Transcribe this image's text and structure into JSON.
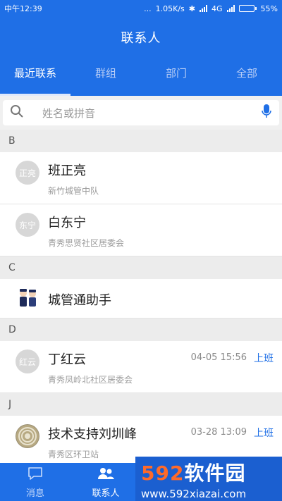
{
  "statusbar": {
    "time": "中午12:39",
    "dots": "...",
    "speed": "1.05K/s",
    "network": "4G",
    "battery": "55%",
    "battery_level": 0.55
  },
  "header": {
    "title": "联系人",
    "tabs": [
      "最近联系",
      "群组",
      "部门",
      "全部"
    ]
  },
  "search": {
    "placeholder": "姓名或拼音"
  },
  "sections": {
    "b": "B",
    "c": "C",
    "d": "D",
    "j": "J"
  },
  "contacts": {
    "banzhengliang": {
      "avatar": "正亮",
      "name": "班正亮",
      "org": "新竹城管中队"
    },
    "baidongning": {
      "avatar": "东宁",
      "name": "白东宁",
      "org": "青秀思贤社区居委会"
    },
    "assistant": {
      "name": "城管通助手"
    },
    "dinghongyun": {
      "avatar": "红云",
      "name": "丁红云",
      "org": "青秀凤岭北社区居委会",
      "time": "04-05 15:56",
      "status": "上班"
    },
    "liuzhenfeng": {
      "name": "技术支持刘圳峰",
      "org": "青秀区环卫站",
      "time": "03-28 13:09",
      "status": "上班"
    }
  },
  "bottom_nav": {
    "messages": "消息",
    "contacts": "联系人"
  },
  "watermark": {
    "brand_digits": "592",
    "brand_text": "软件园",
    "url": "www.592xiazai.com"
  },
  "colors": {
    "primary": "#1f6fe6",
    "status_text": "#1f6fe6"
  }
}
